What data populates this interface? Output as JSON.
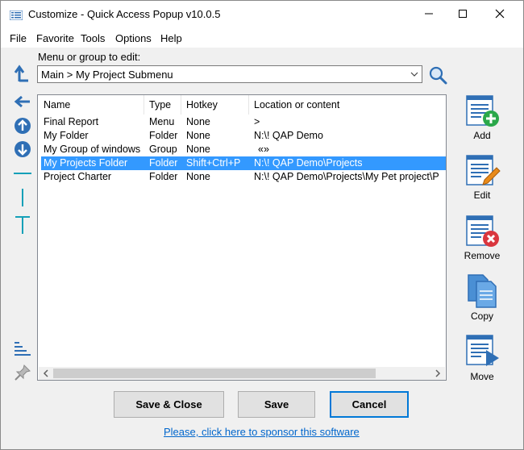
{
  "window": {
    "title": "Customize - Quick Access Popup v10.0.5"
  },
  "menubar": {
    "file": "File",
    "favorite": "Favorite",
    "tools": "Tools",
    "options": "Options",
    "help": "Help"
  },
  "editor": {
    "combo_label": "Menu or group to edit:",
    "combo_value": "Main > My Project Submenu"
  },
  "list": {
    "columns": [
      "Name",
      "Type",
      "Hotkey",
      "Location or content"
    ],
    "rows": [
      {
        "name": "Final Report",
        "type": "Menu",
        "hotkey": "None",
        "location": ">"
      },
      {
        "name": "My Folder",
        "type": "Folder",
        "hotkey": "None",
        "location": "N:\\! QAP Demo"
      },
      {
        "name": "My Group of windows",
        "type": "Group",
        "hotkey": "None",
        "location": "«»"
      },
      {
        "name": "My Projects Folder",
        "type": "Folder",
        "hotkey": "Shift+Ctrl+P",
        "location": "N:\\! QAP Demo\\Projects"
      },
      {
        "name": "Project Charter",
        "type": "Folder",
        "hotkey": "None",
        "location": "N:\\! QAP Demo\\Projects\\My Pet project\\P"
      }
    ],
    "selected_index": 3
  },
  "side_buttons": {
    "add": "Add",
    "edit": "Edit",
    "remove": "Remove",
    "copy": "Copy",
    "move": "Move"
  },
  "buttons": {
    "save_close": "Save & Close",
    "save": "Save",
    "cancel": "Cancel"
  },
  "sponsor": "Please, click here to sponsor this software",
  "colors": {
    "selection": "#3399ff",
    "icon_blue": "#2f6fb5",
    "accent_teal": "#14a0b8",
    "add_green": "#2aa84a",
    "remove_red": "#d9363e",
    "edit_orange": "#e88a1a",
    "link": "#0066cc"
  }
}
